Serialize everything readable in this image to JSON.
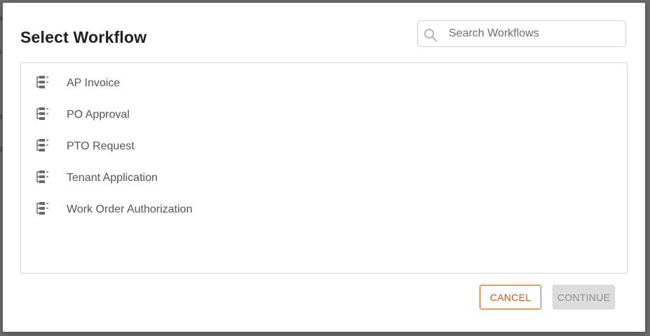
{
  "dialog": {
    "title": "Select Workflow"
  },
  "search": {
    "placeholder": "Search Workflows",
    "value": ""
  },
  "workflows": [
    {
      "label": "AP Invoice",
      "icon": "workflow-icon"
    },
    {
      "label": "PO Approval",
      "icon": "workflow-icon"
    },
    {
      "label": "PTO Request",
      "icon": "workflow-icon"
    },
    {
      "label": "Tenant Application",
      "icon": "workflow-icon"
    },
    {
      "label": "Work Order Authorization",
      "icon": "workflow-icon"
    }
  ],
  "actions": {
    "cancel_label": "CANCEL",
    "continue_label": "CONTINUE",
    "continue_disabled": true
  },
  "colors": {
    "accent": "#d9531e",
    "disabled_bg": "#dcdcdc",
    "text": "#555555"
  }
}
